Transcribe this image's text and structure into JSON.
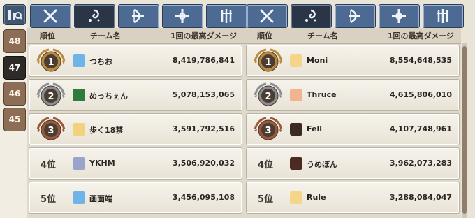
{
  "sidebar": {
    "weeks": [
      {
        "label": "48",
        "active": false
      },
      {
        "label": "47",
        "active": true
      },
      {
        "label": "46",
        "active": false
      },
      {
        "label": "45",
        "active": false
      }
    ]
  },
  "headers": {
    "rank": "順位",
    "team": "チーム名",
    "damage": "1回の最高ダメージ"
  },
  "left_panel": {
    "rows": [
      {
        "rank": "1",
        "rank_label": "",
        "medal": "gold",
        "icon": "globe-team-icon",
        "icon_color": "#6fb4e8",
        "name": "つちお",
        "damage": "8,419,786,841"
      },
      {
        "rank": "2",
        "rank_label": "",
        "medal": "silver",
        "icon": "moon-team-icon",
        "icon_color": "#2f7a3d",
        "name": "めっちぇん",
        "damage": "5,078,153,065"
      },
      {
        "rank": "3",
        "rank_label": "",
        "medal": "bronze",
        "icon": "sparkle-team-icon",
        "icon_color": "#f2d27a",
        "name": "歩く18禁",
        "damage": "3,591,792,516"
      },
      {
        "rank": "",
        "rank_label": "4位",
        "medal": "none",
        "icon": "robot-team-icon",
        "icon_color": "#9aa3c9",
        "name": "YKHM",
        "damage": "3,506,920,032"
      },
      {
        "rank": "",
        "rank_label": "5位",
        "medal": "none",
        "icon": "globe-team-icon",
        "icon_color": "#6fb4e8",
        "name": "画面端",
        "damage": "3,456,095,108"
      }
    ]
  },
  "right_panel": {
    "rows": [
      {
        "rank": "1",
        "rank_label": "",
        "medal": "gold",
        "icon": "cat-team-icon",
        "icon_color": "#f4d58a",
        "name": "Moni",
        "damage": "8,554,648,535"
      },
      {
        "rank": "2",
        "rank_label": "",
        "medal": "silver",
        "icon": "peach-team-icon",
        "icon_color": "#f2b48e",
        "name": "Thruce",
        "damage": "4,615,806,010"
      },
      {
        "rank": "3",
        "rank_label": "",
        "medal": "bronze",
        "icon": "dark-figure-team-icon",
        "icon_color": "#3a2a22",
        "name": "Fell",
        "damage": "4,107,748,961"
      },
      {
        "rank": "",
        "rank_label": "4位",
        "medal": "none",
        "icon": "dark-figure-team-icon",
        "icon_color": "#4a2a22",
        "name": "うめぼん",
        "damage": "3,962,073,283"
      },
      {
        "rank": "",
        "rank_label": "5位",
        "medal": "none",
        "icon": "cat-team-icon",
        "icon_color": "#f4d58a",
        "name": "Rule",
        "damage": "3,288,084,047"
      }
    ]
  },
  "colors": {
    "gold": "#b98a3b",
    "silver": "#8b8e92",
    "bronze": "#9a5a3a",
    "tab_blue": "#4c6a92",
    "tab_dark": "#2a3547"
  }
}
